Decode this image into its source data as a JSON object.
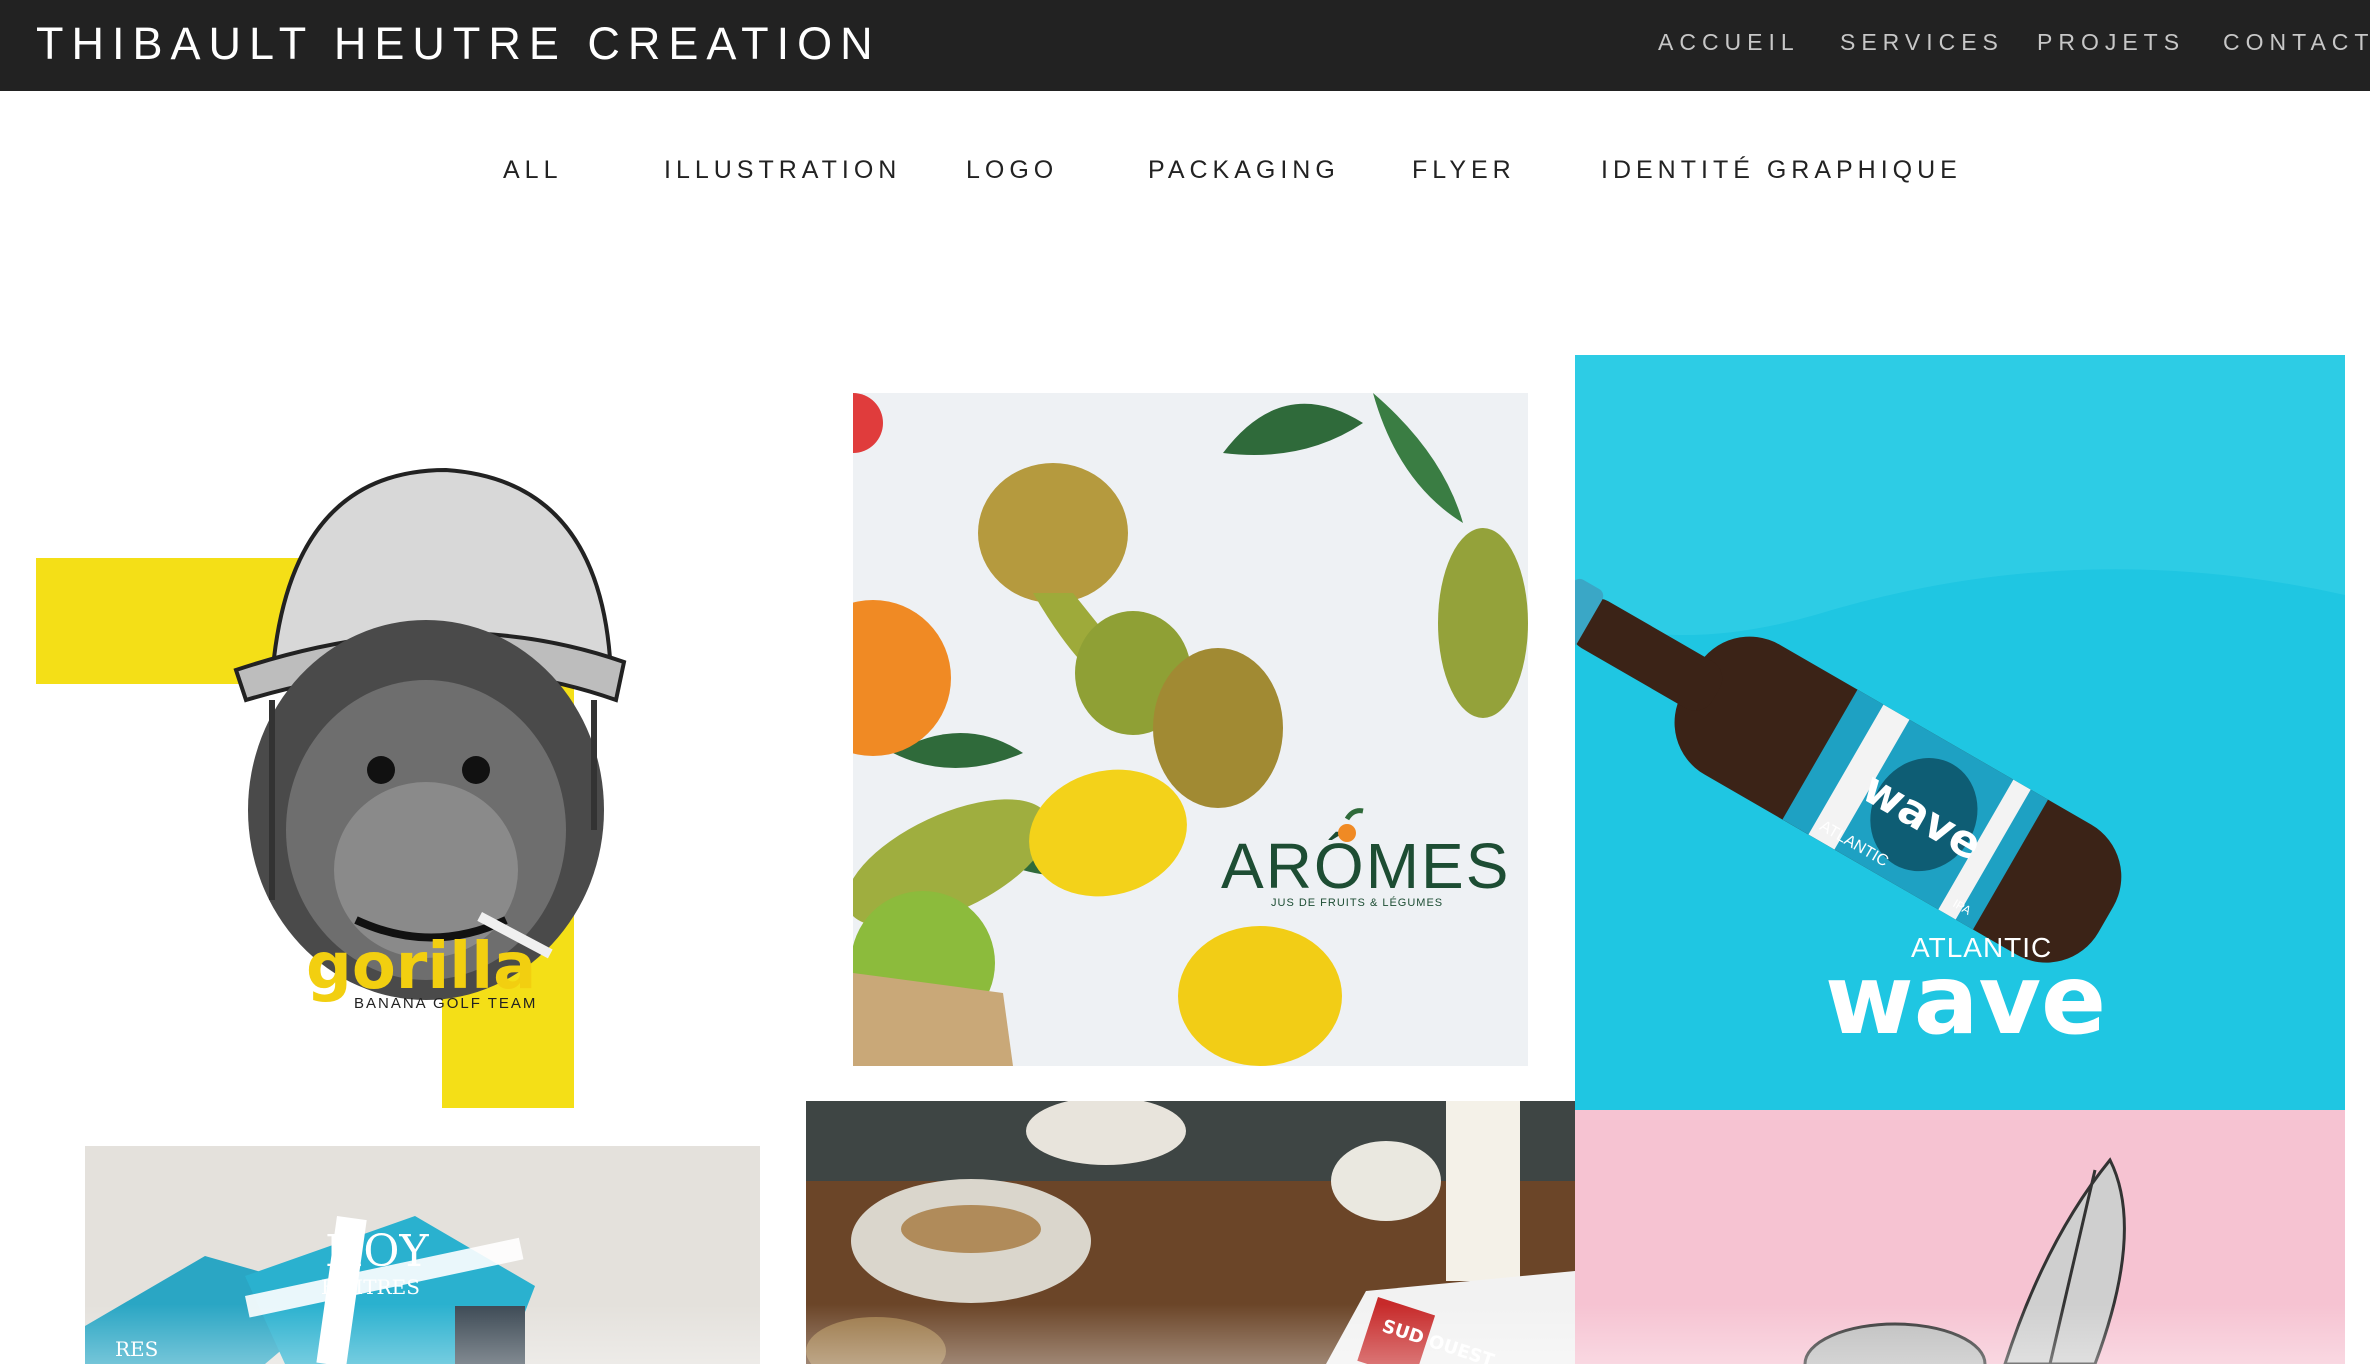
{
  "header": {
    "brand": "THIBAULT HEUTRE CREATION",
    "nav": [
      "ACCUEIL",
      "SERVICES",
      "PROJETS",
      "CONTACT"
    ]
  },
  "filters": [
    "ALL",
    "ILLUSTRATION",
    "LOGO",
    "PACKAGING",
    "FLYER",
    "IDENTITÉ GRAPHIQUE"
  ],
  "colors": {
    "header_bg": "#222222",
    "yellow": "#f4df17",
    "cyan": "#1fc6e2",
    "pink": "#f6c3d2",
    "aromes_green": "#1d4d33"
  },
  "projects": {
    "gorilla": {
      "logo": "gorilla",
      "tagline": "BANANA GOLF TEAM"
    },
    "aromes": {
      "logo": "ARÔMES",
      "tagline": "JUS DE FRUITS & LÉGUMES"
    },
    "atlantic": {
      "line1": "ATLANTIC",
      "line2": "wave",
      "label_small": "ATLANTIC",
      "label_big": "wave",
      "label_ipa": "IPA"
    },
    "hoy": {
      "label": "HOY",
      "label2": "HUITRES",
      "label3": "RES"
    },
    "breakfast": {
      "newspaper": "SUD OUEST"
    },
    "pink": {}
  }
}
